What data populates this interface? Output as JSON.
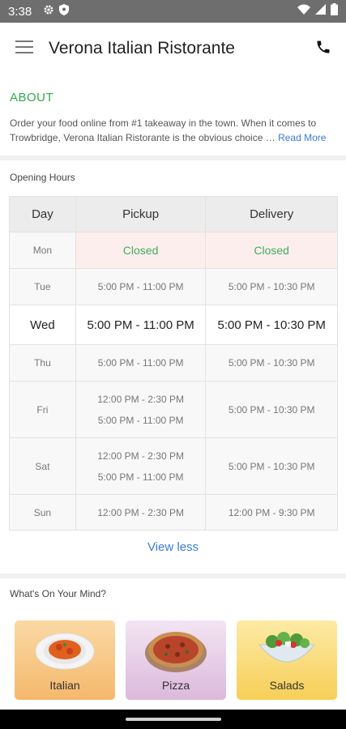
{
  "status_bar": {
    "time": "3:38"
  },
  "app_bar": {
    "title": "Verona Italian Ristorante"
  },
  "about": {
    "heading": "ABOUT",
    "text": "Order your food online from #1 takeaway in the town. When it comes to Trowbridge, Verona Italian Ristorante is the obvious choice …",
    "read_more": "Read More"
  },
  "opening_hours": {
    "heading": "Opening Hours",
    "columns": [
      "Day",
      "Pickup",
      "Delivery"
    ],
    "rows": [
      {
        "day": "Mon",
        "pickup": [
          "Closed"
        ],
        "delivery": [
          "Closed"
        ]
      },
      {
        "day": "Tue",
        "pickup": [
          "5:00 PM - 11:00 PM"
        ],
        "delivery": [
          "5:00 PM - 10:30 PM"
        ]
      },
      {
        "day": "Wed",
        "pickup": [
          "5:00 PM - 11:00 PM"
        ],
        "delivery": [
          "5:00 PM - 10:30 PM"
        ]
      },
      {
        "day": "Thu",
        "pickup": [
          "5:00 PM - 11:00 PM"
        ],
        "delivery": [
          "5:00 PM - 10:30 PM"
        ]
      },
      {
        "day": "Fri",
        "pickup": [
          "12:00 PM - 2:30 PM",
          "5:00 PM - 11:00 PM"
        ],
        "delivery": [
          "5:00 PM - 10:30 PM"
        ]
      },
      {
        "day": "Sat",
        "pickup": [
          "12:00 PM - 2:30 PM",
          "5:00 PM - 11:00 PM"
        ],
        "delivery": [
          "5:00 PM - 10:30 PM"
        ]
      },
      {
        "day": "Sun",
        "pickup": [
          "12:00 PM - 2:30 PM"
        ],
        "delivery": [
          "12:00 PM - 9:30 PM"
        ]
      }
    ],
    "view_less": "View less"
  },
  "whats_on_mind": {
    "heading": "What's On Your Mind?",
    "categories": [
      {
        "label": "Italian",
        "color": "#f7c98a"
      },
      {
        "label": "Pizza",
        "color": "#e7cde6"
      },
      {
        "label": "Salads",
        "color": "#fbdf86"
      }
    ]
  },
  "colors": {
    "accent_green": "#2eaa4b",
    "link_blue": "#3a7bd5",
    "closed_bg": "#fdeeee"
  }
}
